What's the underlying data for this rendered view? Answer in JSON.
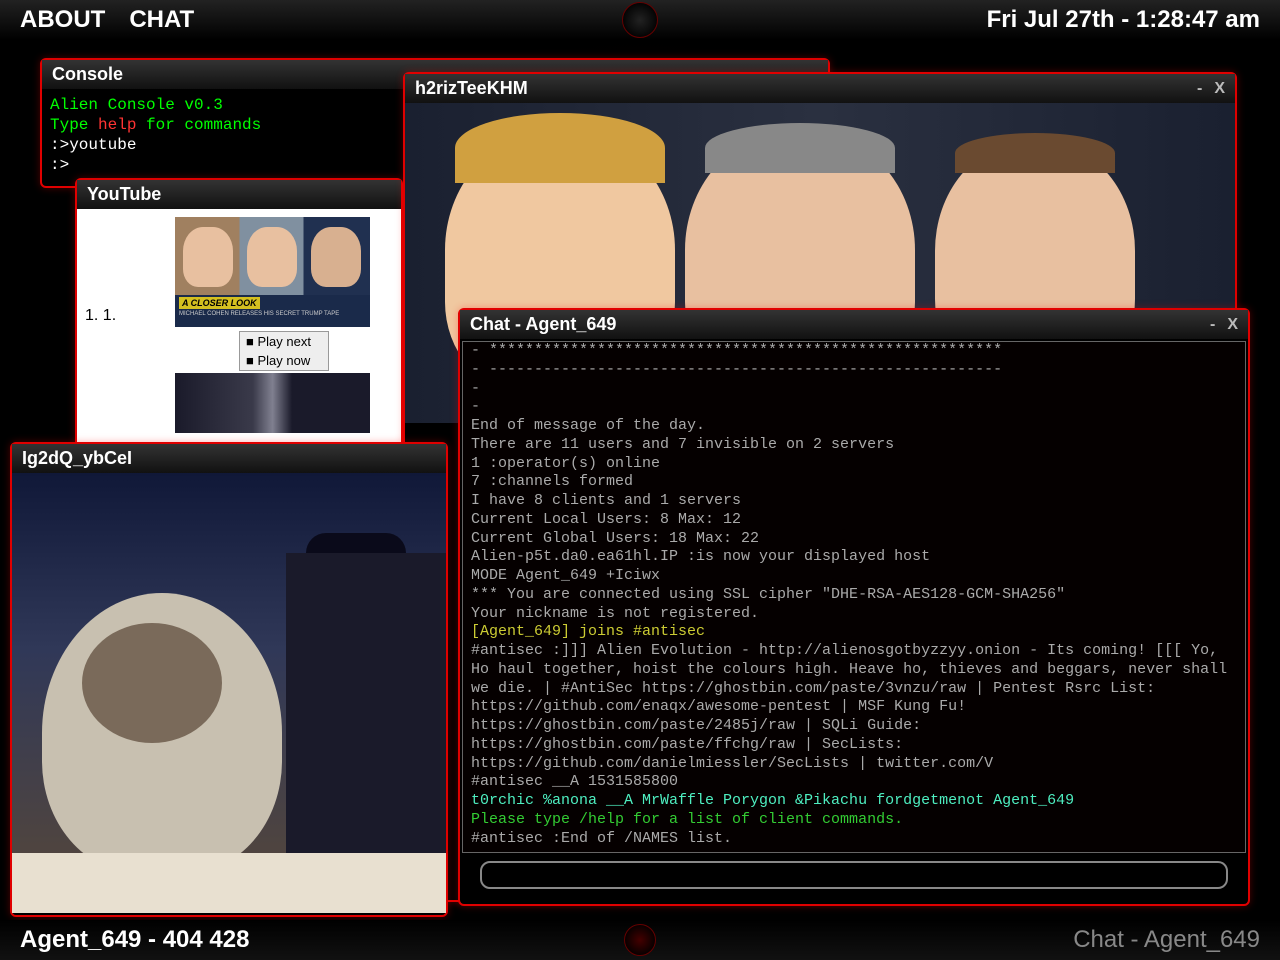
{
  "topbar": {
    "about": "ABOUT",
    "chat": "CHAT",
    "clock": "Fri Jul 27th - 1:28:47 am"
  },
  "console_window": {
    "title": "Console",
    "line1a": "Alien Console v0.3",
    "line2a": "Type ",
    "line2b": "help",
    "line2c": " for commands",
    "line3": ":>youtube",
    "line4": ":>"
  },
  "youtube_window": {
    "title": "YouTube",
    "list_nums": "1.    1.",
    "banner_top": "A CLOSER LOOK",
    "banner_sub": "MICHAEL COHEN RELEASES HIS SECRET TRUMP TAPE",
    "menu_play_next": "Play next",
    "menu_play_now": "Play now"
  },
  "video1_window": {
    "title": "h2rizTeeKHM",
    "minimize": "-",
    "close": "X"
  },
  "video2_window": {
    "title": "Ig2dQ_ybCeI"
  },
  "chat_window": {
    "title": "Chat - Agent_649",
    "minimize": "-",
    "close": "X",
    "messages": [
      {
        "cls": "",
        "text": "- *********************************************************"
      },
      {
        "cls": "",
        "text": "- ---------------------------------------------------------"
      },
      {
        "cls": "",
        "text": "-"
      },
      {
        "cls": "",
        "text": "-"
      },
      {
        "cls": "",
        "text": "End of message of the day."
      },
      {
        "cls": "",
        "text": "There are 11 users and 7 invisible on 2 servers"
      },
      {
        "cls": "",
        "text": "1 :operator(s) online"
      },
      {
        "cls": "",
        "text": "7 :channels formed"
      },
      {
        "cls": "",
        "text": "I have 8 clients and 1 servers"
      },
      {
        "cls": "",
        "text": "Current Local Users: 8 Max: 12"
      },
      {
        "cls": "",
        "text": "Current Global Users: 18 Max: 22"
      },
      {
        "cls": "",
        "text": "Alien-p5t.da0.ea61hl.IP :is now your displayed host"
      },
      {
        "cls": "",
        "text": "MODE Agent_649 +Iciwx"
      },
      {
        "cls": "",
        "text": "*** You are connected using SSL cipher \"DHE-RSA-AES128-GCM-SHA256\""
      },
      {
        "cls": "",
        "text": "Your nickname is not registered."
      },
      {
        "cls": "yellow",
        "text": "[Agent_649] joins #antisec"
      },
      {
        "cls": "",
        "text": "#antisec :]]] Alien Evolution - http://alienosgotbyzzyy.onion - Its coming! [[[ Yo, Ho haul together, hoist the colours high. Heave ho, thieves and beggars, never shall we die. | #AntiSec https://ghostbin.com/paste/3vnzu/raw | Pentest Rsrc List: https://github.com/enaqx/awesome-pentest | MSF Kung Fu! https://ghostbin.com/paste/2485j/raw | SQLi Guide: https://ghostbin.com/paste/ffchg/raw | SecLists: https://github.com/danielmiessler/SecLists | twitter.com/V"
      },
      {
        "cls": "",
        "text": "#antisec __A 1531585800"
      },
      {
        "cls": "cyan",
        "text": "t0rchic %anona __A MrWaffle Porygon &Pikachu fordgetmenot Agent_649"
      },
      {
        "cls": "green",
        "text": "Please type /help for a list of client commands."
      },
      {
        "cls": "",
        "text": "#antisec :End of /NAMES list."
      }
    ]
  },
  "bottombar": {
    "status_left": "Agent_649 - 404 428",
    "status_right": "Chat - Agent_649"
  }
}
